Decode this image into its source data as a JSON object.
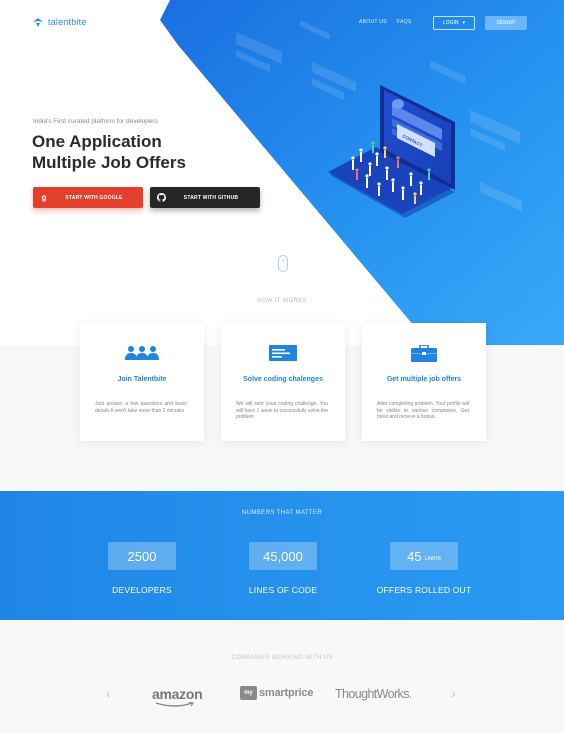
{
  "brand": {
    "name": "talentbite",
    "color": "#2a8ce8"
  },
  "nav": {
    "about": "ABOUT US",
    "faqs": "FAQS",
    "login": "LOGIN",
    "login_caret": "▾",
    "signup": "SIGNUP"
  },
  "hero": {
    "tagline": "India's First curated platform for developers",
    "headline_line1": "One Application",
    "headline_line2": "Multiple Job Offers",
    "google_btn": "START WITH GOOGLE",
    "google_icon_glyph": "g",
    "github_btn": "START WITH GITHUB",
    "illustration_sign": "CONTACT"
  },
  "how_it_works": {
    "title": "HOW IT WORKS",
    "steps": [
      {
        "icon": "people-icon",
        "title": "Join Talentbite",
        "desc": "Just answer a few questions and basic details.It won't take more than 2 minutes"
      },
      {
        "icon": "code-window-icon",
        "title": "Solve coding chalenges",
        "desc": "We will sent youa coding challenge. You will have 1 week to successfully solve the problem"
      },
      {
        "icon": "briefcase-icon",
        "title": "Get multiple job offers",
        "desc": "After completing problem. Your profile will be visible to various companies. Get hired and recieve a bonus."
      }
    ]
  },
  "numbers": {
    "title": "NUMBERS THAT MATTER",
    "stats": [
      {
        "value": "2500",
        "unit": "",
        "label": "DEVELOPERS"
      },
      {
        "value": "45,000",
        "unit": "",
        "label": "LINES OF CODE"
      },
      {
        "value": "45",
        "unit": "LAKHS",
        "label": "OFFERS ROLLED OUT"
      }
    ]
  },
  "companies": {
    "title": "COMPANIES WORKING WITH US",
    "prev_arrow": "‹",
    "next_arrow": "›",
    "logos": {
      "amazon": "amazon",
      "msp_badge": "my",
      "msp_text": "smartprice",
      "thoughtworks": "ThoughtWorks."
    }
  },
  "colors": {
    "primary_blue": "#2693ee",
    "google_red": "#e2402d",
    "github_dark": "#262626"
  }
}
